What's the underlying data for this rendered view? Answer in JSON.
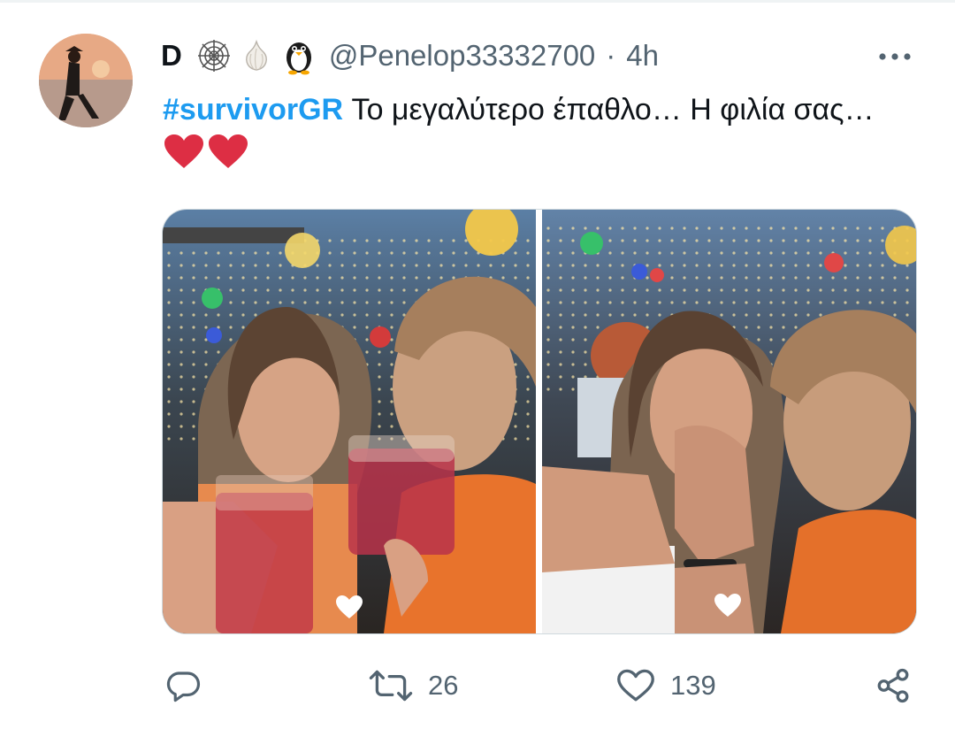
{
  "tweet": {
    "author_name": "D",
    "handle": "@Penelop33332700",
    "separator": "·",
    "time": "4h",
    "text": {
      "hashtag": "#survivorGR",
      "body": " Το μεγαλύτερο έπαθλο… Η φιλία σας…",
      "emoji": "❤️❤️"
    },
    "name_emojis": [
      "spider-web-icon",
      "garlic-icon",
      "penguin-icon"
    ],
    "media": {
      "count": 2,
      "photos": [
        {
          "description_icon": "photo-couple-toasting",
          "alt_icon": "heart-icon"
        },
        {
          "description_icon": "photo-couple-blowing-kiss",
          "alt_icon": "heart-icon"
        }
      ]
    },
    "actions": {
      "reply_count": "",
      "retweet_count": "26",
      "like_count": "139"
    }
  },
  "colors": {
    "hashtag": "#1d9bf0",
    "secondary_text": "#536471",
    "heart": "#e0245e"
  }
}
